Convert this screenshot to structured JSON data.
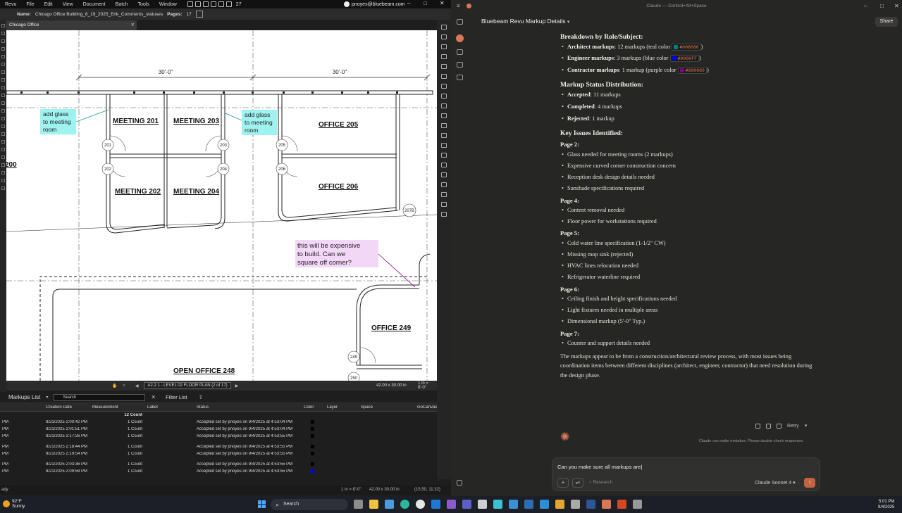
{
  "revu": {
    "menu": [
      "Revu",
      "File",
      "Edit",
      "View",
      "Document",
      "Batch",
      "Tools",
      "Window"
    ],
    "notif_count": "27",
    "user_email": "pnoyes@bluebeam.com",
    "doc_name_label": "Name:",
    "doc_name": "Chicago Office Building_8_19_2025_Erik_Comments_statuses",
    "pages_label": "Pages:",
    "pages": "17",
    "tab_name": "Chicago Office Building_8_19_2025_Erik_Comments_statuses",
    "drawing": {
      "dims": [
        "30'-0\"",
        "30'-0\""
      ],
      "rooms": [
        {
          "name": "MEETING  201"
        },
        {
          "name": "MEETING  203"
        },
        {
          "name": "OFFICE  205"
        },
        {
          "name": "MEETING  202"
        },
        {
          "name": "MEETING  204"
        },
        {
          "name": "OFFICE  206"
        },
        {
          "name": "OFFICE  249"
        },
        {
          "name": "OPEN OFFICE  248"
        },
        {
          "name": "200"
        }
      ],
      "tags": [
        "201",
        "203",
        "205",
        "202",
        "204",
        "206",
        "207B",
        "249",
        "250"
      ],
      "callout1": "add glass to meeting room",
      "callout2": "add glass to meeting room",
      "callout3": "this will be expensive to build. Can we square off corner?"
    },
    "nav": {
      "sheet": "A2.2.1 - LEVEL 02 FLOOR PLAN (2 of 17)",
      "dims": "42.00 x 30.00 in",
      "scale": "1 in = 8'-0\""
    },
    "markups": {
      "title": "Markups List",
      "search_placeholder": "Search",
      "filter_label": "Filter List",
      "columns": [
        "",
        "Creation Date",
        "Measurement",
        "Label",
        "Status",
        "Color",
        "Layer",
        "Space",
        "GoCanvas"
      ],
      "count_summary": "12 Count",
      "rows": [
        {
          "time": "PM",
          "date": "8/21/2025 2:00:42 PM",
          "measurement": "1 Count",
          "status": "Accepted set by pnoyes on 9/4/2025 at 4:53:04 PM",
          "color": "#000000"
        },
        {
          "time": "PM",
          "date": "8/21/2025 2:01:51 PM",
          "measurement": "1 Count",
          "status": "Accepted set by pnoyes on 9/4/2025 at 4:53:04 PM",
          "color": "#000000"
        },
        {
          "time": "PM",
          "date": "8/21/2025 2:17:26 PM",
          "measurement": "1 Count",
          "status": "Accepted set by pnoyes on 9/4/2025 at 4:53:55 PM",
          "color": "#000000"
        },
        {
          "time": "PM",
          "date": "8/21/2025 2:18:44 PM",
          "measurement": "1 Count",
          "status": "Accepted set by pnoyes on 9/4/2025 at 4:53:55 PM",
          "color": "#000000"
        },
        {
          "time": "PM",
          "date": "8/21/2025 2:19:54 PM",
          "measurement": "1 Count",
          "status": "Accepted set by pnoyes on 9/4/2025 at 4:53:55 PM",
          "color": "#000000"
        },
        {
          "time": "PM",
          "date": "8/21/2025 2:03:36 PM",
          "measurement": "1 Count",
          "status": "Accepted set by pnoyes on 9/4/2025 at 4:53:55 PM",
          "color": "#000000"
        },
        {
          "time": "PM",
          "date": "8/21/2025 2:09:59 PM",
          "measurement": "1 Count",
          "status": "Accepted set by pnoyes on 9/4/2025 at 4:53:55 PM",
          "color": "#0000FF"
        }
      ]
    },
    "status_bar": {
      "left": "ady",
      "scale": "1 in = 8'-0\"",
      "dims": "42.00 x 30.00 in",
      "coords": "(15.50, 11.32)"
    }
  },
  "claude": {
    "window_title": "Claude — Control+Alt+Space",
    "conversation_title": "Bluebeam Revu Markup Details",
    "share_label": "Share",
    "sections": {
      "role_heading": "Breakdown by Role/Subject:",
      "roles": [
        {
          "label": "Architect markups",
          "text": ": 12 markups (teal color ",
          "code": "#008080",
          "close": ")",
          "color": "#008080"
        },
        {
          "label": "Engineer markups",
          "text": ": 3 markups (blue color ",
          "code": "#0000FF",
          "close": ")",
          "color": "#0000FF"
        },
        {
          "label": "Contractor markups",
          "text": ": 1 markup (purple color ",
          "code": "#800080",
          "close": ")",
          "color": "#800080"
        }
      ],
      "status_heading": "Markup Status Distribution:",
      "statuses": [
        {
          "label": "Accepted",
          "text": ": 11 markups"
        },
        {
          "label": "Completed",
          "text": ": 4 markups"
        },
        {
          "label": "Rejected",
          "text": ": 1 markup"
        }
      ],
      "issues_heading": "Key Issues Identified:",
      "pages": [
        {
          "title": "Page 2:",
          "items": [
            "Glass needed for meeting rooms (2 markups)",
            "Expensive curved corner construction concern",
            "Reception desk design details needed",
            "Sunshade specifications required"
          ]
        },
        {
          "title": "Page 4:",
          "items": [
            "Content removal needed",
            "Floor power for workstations required"
          ]
        },
        {
          "title": "Page 5:",
          "items": [
            "Cold water line specification (1-1/2\" CW)",
            "Missing mop sink (rejected)",
            "HVAC lines relocation needed",
            "Refrigerator waterline required"
          ]
        },
        {
          "title": "Page 6:",
          "items": [
            "Ceiling finish and height specifications needed",
            "Light fixtures needed in multiple areas",
            "Dimensional markup (5'-0\" Typ.)"
          ]
        },
        {
          "title": "Page 7:",
          "items": [
            "Counter and support details needed"
          ]
        }
      ],
      "summary": "The markups appear to be from a construction/architectural review process, with most issues being coordination items between different disciplines (architect, engineer, contractor) that need resolution during the design phase."
    },
    "retry_label": "Retry",
    "disclaimer": "Claude can make mistakes. Please double-check responses.",
    "composer": {
      "value": "Can you make sure all markups are",
      "research_label": "Research",
      "model_label": "Claude Sonnet 4"
    }
  },
  "taskbar": {
    "weather_temp": "92°F",
    "weather_cond": "Sunny",
    "search_label": "Search",
    "time": "5:01 PM",
    "date": "9/4/2025"
  }
}
